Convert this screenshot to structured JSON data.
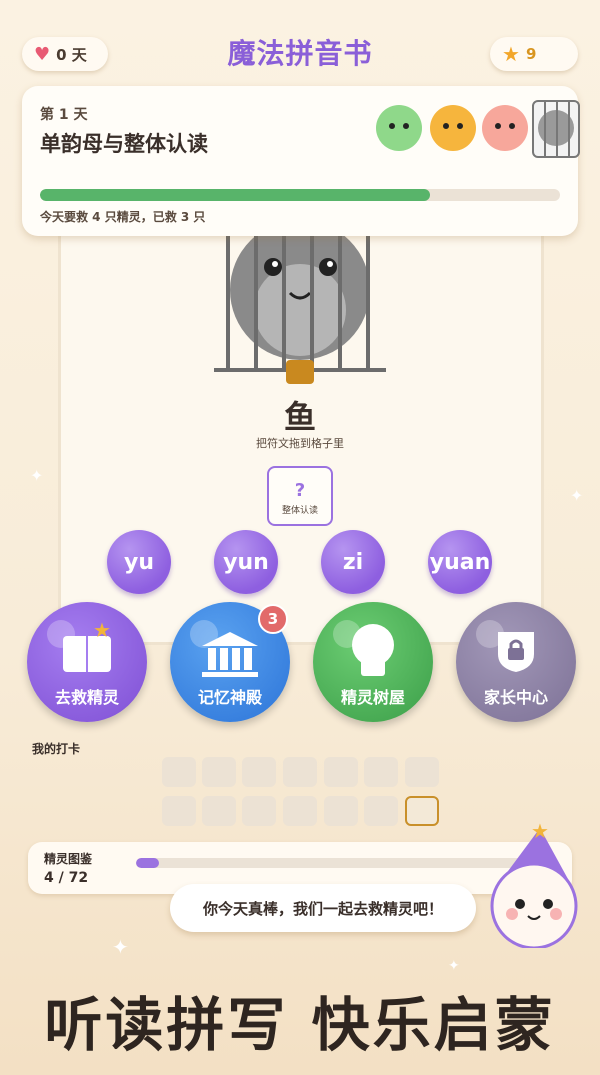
{
  "header": {
    "title": "魔法拼音书",
    "hearts": "0 天",
    "stars": "9"
  },
  "lesson": {
    "day": "第 1 天",
    "title": "单韵母与整体认读",
    "progress": 0.75,
    "status": "今天要救 4 只精灵，已救 3 只",
    "creatures": [
      "green-creature",
      "orange-creature",
      "pink-creature",
      "gray-caged-creature"
    ]
  },
  "puzzle": {
    "character": "鱼",
    "hint": "把符文拖到格子里",
    "slot_mark": "?",
    "slot_label": "整体认读",
    "options": [
      "yu",
      "yun",
      "zi",
      "yuan"
    ]
  },
  "menu": {
    "rescue": "去救精灵",
    "memory": "记忆神殿",
    "memory_badge": "3",
    "treehouse": "精灵树屋",
    "parent": "家长中心"
  },
  "checkin": {
    "label": "我的打卡"
  },
  "dex": {
    "label": "精灵图鉴",
    "count": "4 / 72",
    "progress": 0.055
  },
  "mascot": {
    "speech": "你今天真棒，我们一起去救精灵吧！"
  },
  "slogan": "听读拼写 快乐启蒙",
  "colors": {
    "accent_purple": "#8e5fe0",
    "blue": "#3a86e8",
    "green": "#4bb35a",
    "gray_purple": "#8a7fa0",
    "progress_green": "#58b46a"
  }
}
